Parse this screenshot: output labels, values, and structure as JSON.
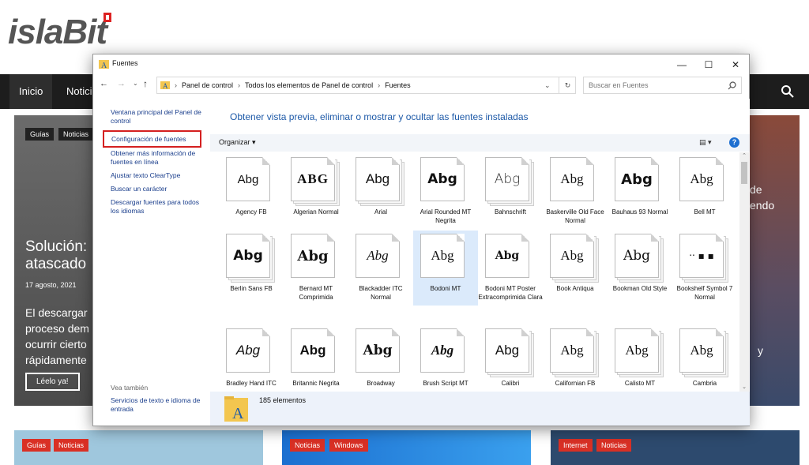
{
  "site": {
    "logo": "islaBit",
    "nav": [
      "Inicio",
      "Noticias"
    ]
  },
  "bg": {
    "tags_top": [
      "Guías",
      "Noticias"
    ],
    "hero_title": "Solución: atascado",
    "hero_date": "17 agosto, 2021",
    "hero_excerpt": "El descargar proceso dem ocurrir cierto rápidamente",
    "read_button": "Léelo ya!",
    "right_text1": "de",
    "right_text2": "endo",
    "right_text3": "y",
    "cards": [
      [
        "Guías",
        "Noticias"
      ],
      [
        "Noticias",
        "Windows"
      ],
      [
        "Internet",
        "Noticias"
      ]
    ]
  },
  "window": {
    "title": "Fuentes",
    "minimize": "—",
    "maximize": "☐",
    "close": "✕",
    "breadcrumb": [
      "Panel de control",
      "Todos los elementos de Panel de control",
      "Fuentes"
    ],
    "search_placeholder": "Buscar en Fuentes",
    "left_links": [
      "Ventana principal del Panel de control",
      "Configuración de fuentes",
      "Obtener más información de fuentes en línea",
      "Ajustar texto ClearType",
      "Buscar un carácter",
      "Descargar fuentes para todos los idiomas"
    ],
    "see_also": "Vea también",
    "see_also_link": "Servicios de texto e idioma de entrada",
    "heading": "Obtener vista previa, eliminar o mostrar y ocultar las fuentes instaladas",
    "organize": "Organizar",
    "status": "185 elementos",
    "fonts": [
      {
        "name": "Agency FB",
        "sample": "Abg"
      },
      {
        "name": "Algerian Normal",
        "sample": "ABG"
      },
      {
        "name": "Arial",
        "sample": "Abg"
      },
      {
        "name": "Arial Rounded MT Negrita",
        "sample": "Abg"
      },
      {
        "name": "Bahnschrift",
        "sample": "Abg"
      },
      {
        "name": "Baskerville Old Face Normal",
        "sample": "Abg"
      },
      {
        "name": "Bauhaus 93 Normal",
        "sample": "Abg"
      },
      {
        "name": "Bell MT",
        "sample": "Abg"
      },
      {
        "name": "Berlin Sans FB",
        "sample": "Abg"
      },
      {
        "name": "Bernard MT Comprimida",
        "sample": "Abg"
      },
      {
        "name": "Blackadder ITC Normal",
        "sample": "Abg"
      },
      {
        "name": "Bodoni MT",
        "sample": "Abg"
      },
      {
        "name": "Bodoni MT Poster Extracomprimida Clara",
        "sample": "Abg"
      },
      {
        "name": "Book Antiqua",
        "sample": "Abg"
      },
      {
        "name": "Bookman Old Style",
        "sample": "Abg"
      },
      {
        "name": "Bookshelf Symbol 7 Normal",
        "sample": "‧‧ ▪ ▪"
      },
      {
        "name": "Bradley Hand ITC",
        "sample": "Abg"
      },
      {
        "name": "Britannic Negrita",
        "sample": "Abg"
      },
      {
        "name": "Broadway",
        "sample": "Abg"
      },
      {
        "name": "Brush Script MT",
        "sample": "Abg"
      },
      {
        "name": "Calibri",
        "sample": "Abg"
      },
      {
        "name": "Californian FB",
        "sample": "Abg"
      },
      {
        "name": "Calisto MT",
        "sample": "Abg"
      },
      {
        "name": "Cambria",
        "sample": "Abg"
      }
    ]
  },
  "colors": {
    "accent": "#d93025",
    "link": "#1a3e8c",
    "heading": "#1e5aa8"
  }
}
